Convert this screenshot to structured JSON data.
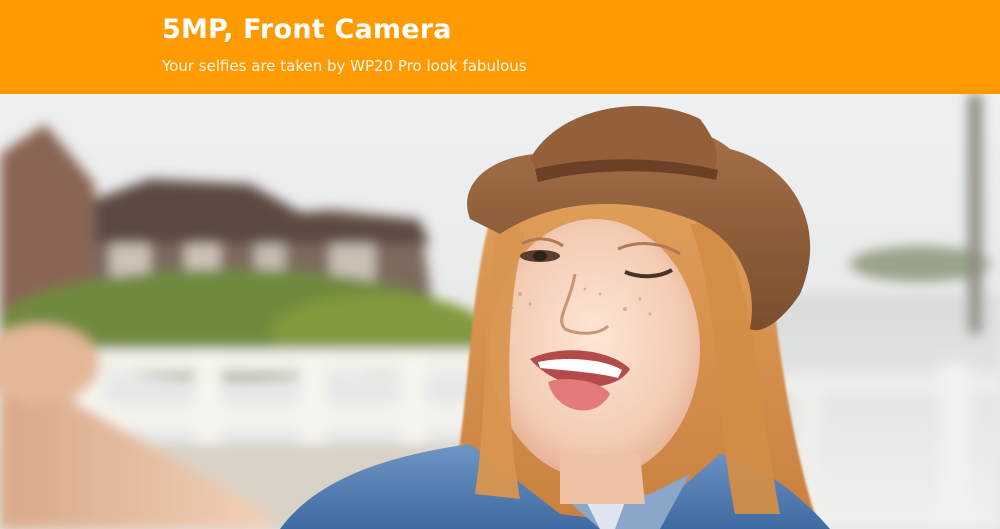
{
  "banner": {
    "title": "5MP, Front Camera",
    "subtitle": "Your selfies are taken by WP20 Pro look fabulous",
    "background_color": "#ff9a00",
    "text_color": "#ffffff"
  },
  "photo": {
    "subject": "smiling-woman-selfie-in-hat",
    "scene": "blurred-houses-and-white-railing-background"
  }
}
